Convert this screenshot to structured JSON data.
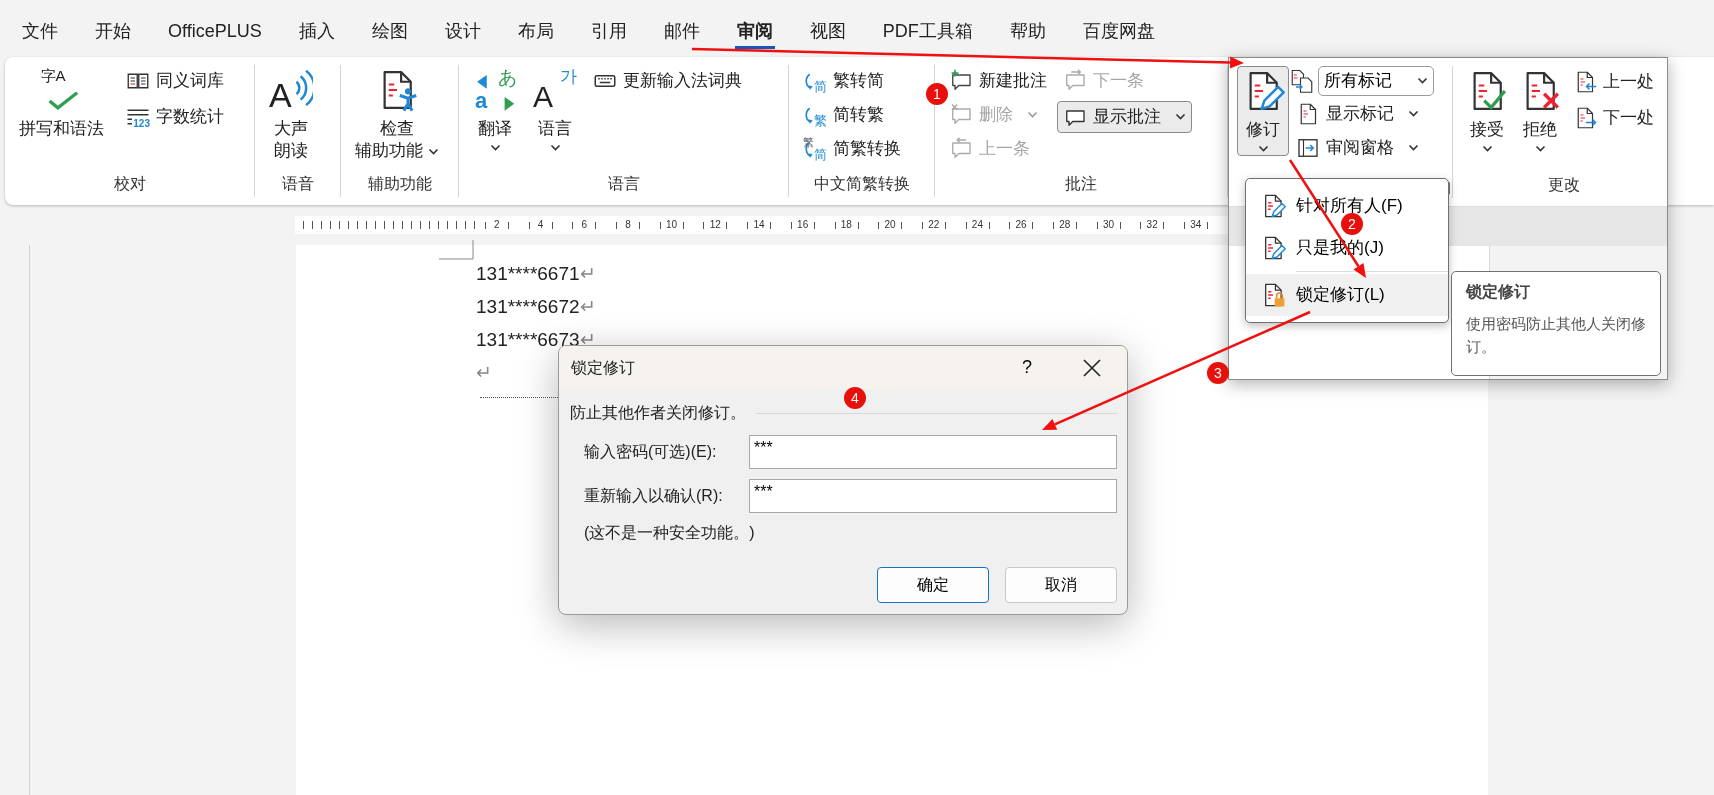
{
  "tabs": [
    {
      "label": "文件",
      "selected": false
    },
    {
      "label": "开始",
      "selected": false
    },
    {
      "label": "OfficePLUS",
      "selected": false
    },
    {
      "label": "插入",
      "selected": false
    },
    {
      "label": "绘图",
      "selected": false
    },
    {
      "label": "设计",
      "selected": false
    },
    {
      "label": "布局",
      "selected": false
    },
    {
      "label": "引用",
      "selected": false
    },
    {
      "label": "邮件",
      "selected": false
    },
    {
      "label": "审阅",
      "selected": true
    },
    {
      "label": "视图",
      "selected": false
    },
    {
      "label": "PDF工具箱",
      "selected": false
    },
    {
      "label": "帮助",
      "selected": false
    },
    {
      "label": "百度网盘",
      "selected": false
    }
  ],
  "ribbon": {
    "groups": [
      {
        "label": "校对",
        "columns": [
          [
            {
              "kind": "large",
              "label": "拼写和语法",
              "glyphs": [
                "字A"
              ]
            }
          ],
          [
            {
              "kind": "small",
              "label": "同义词库"
            },
            {
              "kind": "small",
              "label": "字数统计",
              "glyphs": [
                "123"
              ]
            }
          ]
        ]
      },
      {
        "label": "语音",
        "columns": [
          [
            {
              "kind": "large",
              "label_lines": [
                "大声",
                "朗读"
              ],
              "glyphs": [
                "A"
              ]
            }
          ]
        ]
      },
      {
        "label": "辅助功能",
        "columns": [
          [
            {
              "kind": "large",
              "label_lines": [
                "检查",
                "辅助功能"
              ],
              "dropdown": true
            }
          ]
        ]
      },
      {
        "label": "语言",
        "columns": [
          [
            {
              "kind": "large",
              "label": "翻译",
              "dropdown": true,
              "glyphs": [
                "a",
                "あ"
              ]
            }
          ],
          [
            {
              "kind": "large",
              "label": "语言",
              "dropdown": true,
              "glyphs": [
                "A",
                "가"
              ]
            }
          ],
          [
            {
              "kind": "small",
              "label": "更新输入法词典"
            }
          ]
        ]
      },
      {
        "label": "中文简繁转换",
        "columns": [
          [
            {
              "kind": "small",
              "label": "繁转简",
              "glyphs": [
                "简"
              ]
            },
            {
              "kind": "small",
              "label": "简转繁",
              "glyphs": [
                "繁"
              ]
            },
            {
              "kind": "small",
              "label": "简繁转换",
              "glyphs": [
                "繁",
                "简"
              ]
            }
          ]
        ]
      },
      {
        "label": "批注",
        "columns": [
          [
            {
              "kind": "small",
              "label": "新建批注",
              "disabled": false
            },
            {
              "kind": "small",
              "label": "删除",
              "disabled": true,
              "dropdown": true
            },
            {
              "kind": "small",
              "label": "上一条",
              "disabled": true
            }
          ],
          [
            {
              "kind": "small",
              "label": "下一条",
              "disabled": true
            },
            {
              "kind": "small",
              "label": "显示批注",
              "disabled": false,
              "pressed": true,
              "dropdown": true
            }
          ]
        ]
      }
    ]
  },
  "review_panel": {
    "groups": [
      {
        "launcher": true,
        "columns": [
          [
            {
              "kind": "large",
              "label": "修订",
              "pressed": true,
              "dropdown": true
            }
          ],
          [
            {
              "kind": "combo",
              "value": "所有标记"
            },
            {
              "kind": "small",
              "label": "显示标记",
              "dropdown": true
            },
            {
              "kind": "small",
              "label": "审阅窗格",
              "dropdown": true
            }
          ]
        ]
      },
      {
        "label": "更改",
        "columns": [
          [
            {
              "kind": "large",
              "label": "接受",
              "dropdown": true
            }
          ],
          [
            {
              "kind": "large",
              "label": "拒绝",
              "dropdown": true
            }
          ],
          [
            {
              "kind": "small",
              "label": "上一处"
            },
            {
              "kind": "small",
              "label": "下一处"
            }
          ]
        ]
      }
    ],
    "menu": [
      {
        "label": "针对所有人(F)",
        "selected": false
      },
      {
        "label": "只是我的(J)",
        "selected": false
      },
      {
        "label": "锁定修订(L)",
        "selected": true
      }
    ],
    "tooltip": {
      "title": "锁定修订",
      "text": "使用密码防止其他人关闭修订。"
    }
  },
  "ruler": {
    "labels": [
      "2",
      "4",
      "6",
      "8",
      "10",
      "12",
      "14",
      "16",
      "18",
      "20",
      "22",
      "24",
      "26",
      "28",
      "30",
      "32",
      "34"
    ]
  },
  "document": {
    "lines": [
      {
        "text": "131****6671",
        "mark": "↵"
      },
      {
        "text": "131****6672",
        "mark": "↵"
      },
      {
        "text": "131****6673",
        "mark": "↵"
      },
      {
        "mark": "↵"
      }
    ]
  },
  "dialog": {
    "title": "锁定修订",
    "help": "?",
    "heading": "防止其他作者关闭修订。",
    "fields": [
      {
        "label": "输入密码(可选)(E):",
        "value": "***"
      },
      {
        "label": "重新输入以确认(R):",
        "value": "***"
      }
    ],
    "note": "(这不是一种安全功能。)",
    "buttons": [
      {
        "label": "确定",
        "default": true
      },
      {
        "label": "取消",
        "default": false
      }
    ]
  },
  "annotations": [
    {
      "label": "1"
    },
    {
      "label": "2"
    },
    {
      "label": "3"
    },
    {
      "label": "4"
    }
  ]
}
